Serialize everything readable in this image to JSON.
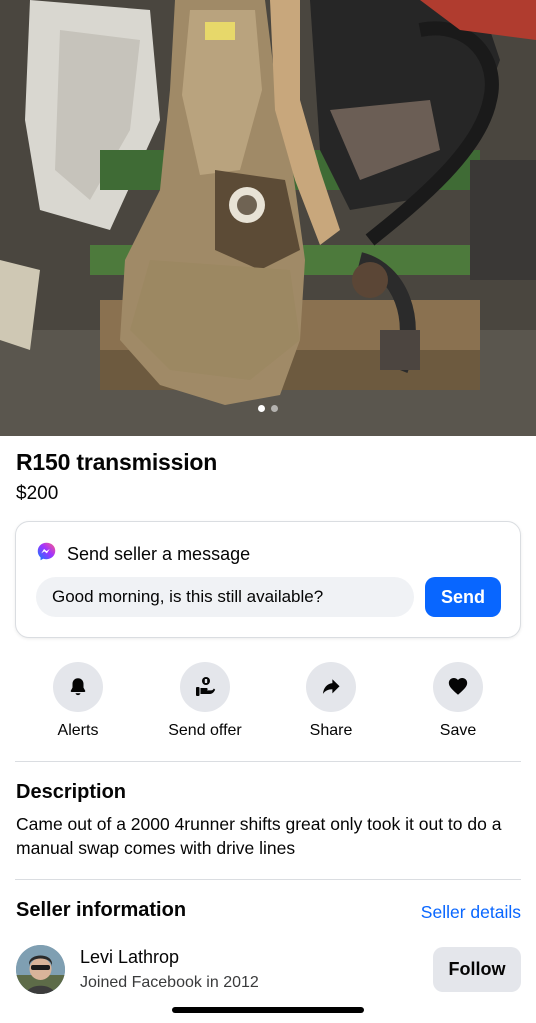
{
  "listing": {
    "title": "R150 transmission",
    "price": "$200",
    "photo_icon": "transmission-photo",
    "photo_count": 2,
    "photo_active_index": 0
  },
  "message": {
    "heading": "Send seller a message",
    "input_value": "Good morning, is this still available?",
    "send_label": "Send"
  },
  "actions": [
    {
      "label": "Alerts",
      "icon": "bell-icon"
    },
    {
      "label": "Send offer",
      "icon": "offer-icon"
    },
    {
      "label": "Share",
      "icon": "share-icon"
    },
    {
      "label": "Save",
      "icon": "heart-icon"
    }
  ],
  "description": {
    "heading": "Description",
    "text": "Came out of a 2000 4runner shifts great only took it out to do a manual swap comes with drive lines"
  },
  "seller": {
    "heading": "Seller information",
    "details_link": "Seller details",
    "name": "Levi Lathrop",
    "joined": "Joined Facebook in 2012",
    "follow_label": "Follow"
  },
  "colors": {
    "accent": "#0866ff",
    "button_gray": "#e4e6eb",
    "input_gray": "#f0f2f5"
  }
}
